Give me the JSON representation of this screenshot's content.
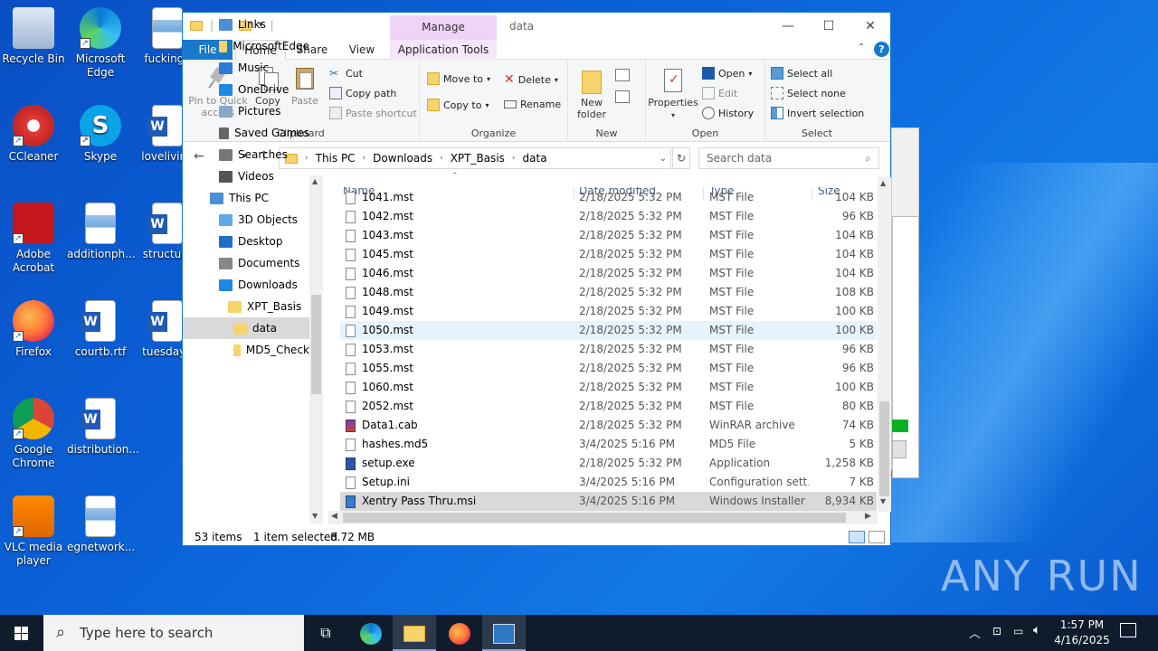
{
  "desktop": {
    "icons": [
      {
        "label": "Recycle Bin",
        "icon": "recycle-bin-icon"
      },
      {
        "label": "Microsoft Edge",
        "icon": "edge-icon"
      },
      {
        "label": "fuckingo",
        "icon": "image-file-icon"
      },
      {
        "label": "CCleaner",
        "icon": "ccleaner-icon"
      },
      {
        "label": "Skype",
        "icon": "skype-icon"
      },
      {
        "label": "loveliving",
        "icon": "word-doc-icon"
      },
      {
        "label": "Adobe Acrobat",
        "icon": "acrobat-icon"
      },
      {
        "label": "additionph...",
        "icon": "image-file-icon"
      },
      {
        "label": "structure",
        "icon": "word-doc-icon"
      },
      {
        "label": "Firefox",
        "icon": "firefox-icon"
      },
      {
        "label": "courtb.rtf",
        "icon": "word-doc-icon"
      },
      {
        "label": "tuesdayb",
        "icon": "word-doc-icon"
      },
      {
        "label": "Google Chrome",
        "icon": "chrome-icon"
      },
      {
        "label": "distribution...",
        "icon": "word-doc-icon"
      },
      {
        "label": "VLC media player",
        "icon": "vlc-icon"
      },
      {
        "label": "egnetwork...",
        "icon": "image-file-icon"
      }
    ],
    "watermark": "ANY RUN"
  },
  "window": {
    "title": "data",
    "manage_tab": "Manage",
    "tabs": {
      "file": "File",
      "home": "Home",
      "share": "Share",
      "view": "View",
      "app_tools": "Application Tools"
    },
    "ribbon": {
      "clipboard": {
        "label": "Clipboard",
        "pin": "Pin to Quick access",
        "copy": "Copy",
        "paste": "Paste",
        "cut": "Cut",
        "copy_path": "Copy path",
        "paste_shortcut": "Paste shortcut"
      },
      "organize": {
        "label": "Organize",
        "move_to": "Move to",
        "copy_to": "Copy to",
        "delete": "Delete",
        "rename": "Rename"
      },
      "new": {
        "label": "New",
        "new_folder": "New folder"
      },
      "open": {
        "label": "Open",
        "properties": "Properties",
        "open": "Open",
        "edit": "Edit",
        "history": "History"
      },
      "select": {
        "label": "Select",
        "select_all": "Select all",
        "select_none": "Select none",
        "invert": "Invert selection"
      }
    },
    "address": {
      "crumbs": [
        "This PC",
        "Downloads",
        "XPT_Basis",
        "data"
      ],
      "search_placeholder": "Search data"
    },
    "nav_pane": [
      {
        "label": "Links",
        "indent": 1
      },
      {
        "label": "MicrosoftEdge",
        "indent": 1
      },
      {
        "label": "Music",
        "indent": 1
      },
      {
        "label": "OneDrive",
        "indent": 1
      },
      {
        "label": "Pictures",
        "indent": 1
      },
      {
        "label": "Saved Games",
        "indent": 1
      },
      {
        "label": "Searches",
        "indent": 1
      },
      {
        "label": "Videos",
        "indent": 1
      },
      {
        "label": "This PC",
        "indent": 0
      },
      {
        "label": "3D Objects",
        "indent": 1
      },
      {
        "label": "Desktop",
        "indent": 1
      },
      {
        "label": "Documents",
        "indent": 1
      },
      {
        "label": "Downloads",
        "indent": 1
      },
      {
        "label": "XPT_Basis",
        "indent": 2
      },
      {
        "label": "data",
        "indent": 3
      },
      {
        "label": "MD5_Check",
        "indent": 3
      }
    ],
    "columns": {
      "name": "Name",
      "date": "Date modified",
      "type": "Type",
      "size": "Size"
    },
    "files": [
      {
        "name": "1041.mst",
        "date": "2/18/2025 5:32 PM",
        "type": "MST File",
        "size": "104 KB"
      },
      {
        "name": "1042.mst",
        "date": "2/18/2025 5:32 PM",
        "type": "MST File",
        "size": "96 KB"
      },
      {
        "name": "1043.mst",
        "date": "2/18/2025 5:32 PM",
        "type": "MST File",
        "size": "104 KB"
      },
      {
        "name": "1045.mst",
        "date": "2/18/2025 5:32 PM",
        "type": "MST File",
        "size": "104 KB"
      },
      {
        "name": "1046.mst",
        "date": "2/18/2025 5:32 PM",
        "type": "MST File",
        "size": "104 KB"
      },
      {
        "name": "1048.mst",
        "date": "2/18/2025 5:32 PM",
        "type": "MST File",
        "size": "108 KB"
      },
      {
        "name": "1049.mst",
        "date": "2/18/2025 5:32 PM",
        "type": "MST File",
        "size": "100 KB"
      },
      {
        "name": "1050.mst",
        "date": "2/18/2025 5:32 PM",
        "type": "MST File",
        "size": "100 KB"
      },
      {
        "name": "1053.mst",
        "date": "2/18/2025 5:32 PM",
        "type": "MST File",
        "size": "96 KB"
      },
      {
        "name": "1055.mst",
        "date": "2/18/2025 5:32 PM",
        "type": "MST File",
        "size": "96 KB"
      },
      {
        "name": "1060.mst",
        "date": "2/18/2025 5:32 PM",
        "type": "MST File",
        "size": "100 KB"
      },
      {
        "name": "2052.mst",
        "date": "2/18/2025 5:32 PM",
        "type": "MST File",
        "size": "80 KB"
      },
      {
        "name": "Data1.cab",
        "date": "2/18/2025 5:32 PM",
        "type": "WinRAR archive",
        "size": "74 KB"
      },
      {
        "name": "hashes.md5",
        "date": "3/4/2025 5:16 PM",
        "type": "MD5 File",
        "size": "5 KB"
      },
      {
        "name": "setup.exe",
        "date": "2/18/2025 5:32 PM",
        "type": "Application",
        "size": "1,258 KB"
      },
      {
        "name": "Setup.ini",
        "date": "3/4/2025 5:16 PM",
        "type": "Configuration sett...",
        "size": "7 KB"
      },
      {
        "name": "Xentry Pass Thru.msi",
        "date": "3/4/2025 5:16 PM",
        "type": "Windows Installer ...",
        "size": "8,934 KB"
      }
    ],
    "status": {
      "items": "53 items",
      "selected": "1 item selected",
      "size": "8.72 MB"
    }
  },
  "taskbar": {
    "search_placeholder": "Type here to search",
    "apps": [
      "task-view-icon",
      "edge-icon",
      "file-explorer-icon",
      "firefox-icon",
      "installer-icon"
    ],
    "time": "1:57 PM",
    "date": "4/16/2025"
  }
}
